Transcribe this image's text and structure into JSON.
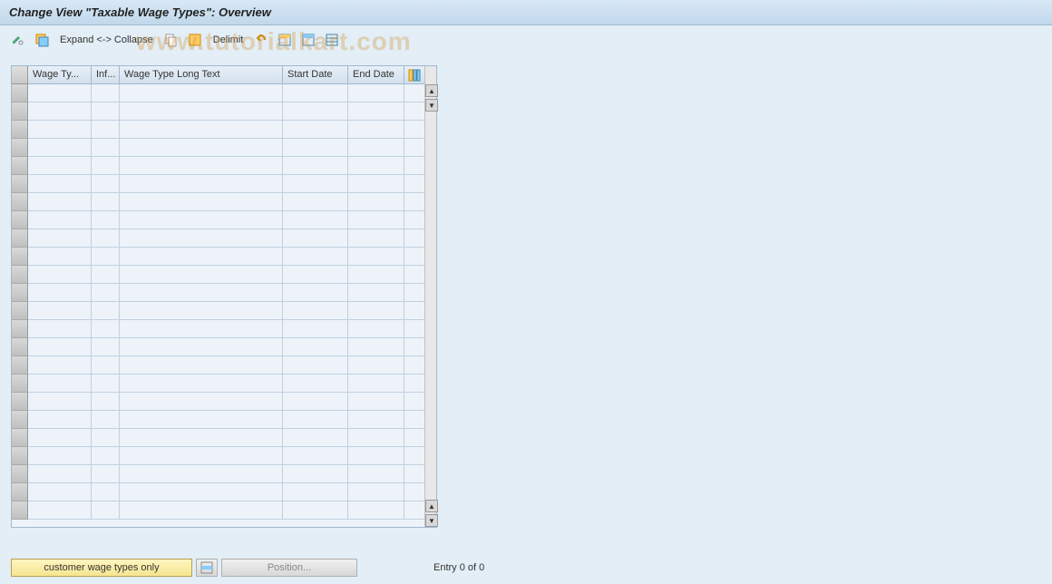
{
  "title": "Change View \"Taxable Wage Types\": Overview",
  "toolbar": {
    "expand_collapse": "Expand <-> Collapse",
    "delimit": "Delimit"
  },
  "watermark": "www.tutorialkart.com",
  "table": {
    "columns": {
      "wage_type": "Wage Ty...",
      "inf": "Inf...",
      "long_text": "Wage Type Long Text",
      "start_date": "Start Date",
      "end_date": "End Date"
    },
    "row_count": 24
  },
  "footer": {
    "customer_btn": "customer wage types only",
    "position_btn": "Position...",
    "entry_text": "Entry 0 of 0"
  }
}
